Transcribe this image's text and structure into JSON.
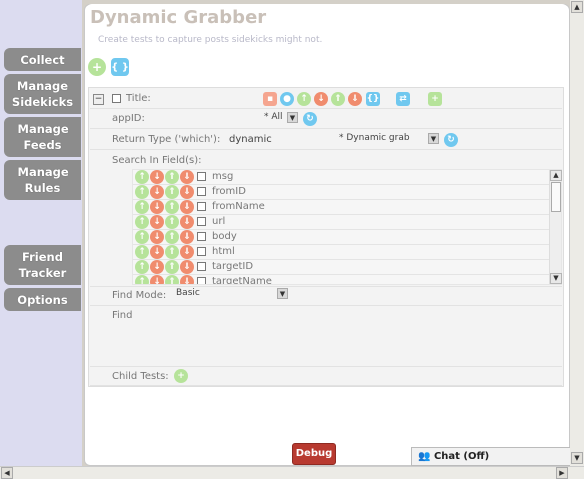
{
  "header": {
    "title": "Dynamic Grabber",
    "subtitle": "Create tests to capture posts sidekicks might not."
  },
  "nav": [
    {
      "label": "Collect"
    },
    {
      "label": "Manage Sidekicks"
    },
    {
      "label": "Manage Feeds"
    },
    {
      "label": "Manage Rules"
    },
    {
      "label": "Friend Tracker"
    },
    {
      "label": "Options"
    }
  ],
  "toolbar": {
    "add_icon": "+",
    "braces_icon": "{ }"
  },
  "test": {
    "title_label": "Title:",
    "appid_label": "appID:",
    "appid_value": "* All",
    "return_type_label": "Return Type ('which'):",
    "return_type_value": "dynamic",
    "return_select_value": "* Dynamic grab",
    "search_label": "Search In Field(s):",
    "fields": [
      "msg",
      "fromID",
      "fromName",
      "url",
      "body",
      "html",
      "targetID",
      "targetName"
    ],
    "find_mode_label": "Find Mode:",
    "find_mode_value": "Basic",
    "find_label": "Find:",
    "child_tests_label": "Child Tests:"
  },
  "debug_label": "Debug",
  "chat_label": "Chat (Off)",
  "colors": {
    "nav_bg": "#8c8c8c",
    "debug_bg": "#b83a30",
    "title_color": "#c9c0b8"
  }
}
